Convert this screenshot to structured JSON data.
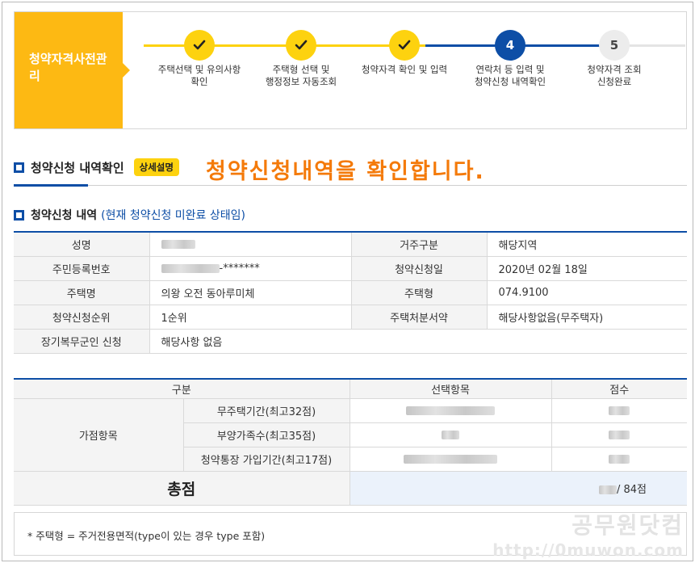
{
  "steps": {
    "tag": "청약자격사전관리",
    "items": [
      {
        "num": "",
        "icon": "check-icon",
        "label1": "주택선택 및 유의사항",
        "label2": "확인",
        "state": "done"
      },
      {
        "num": "",
        "icon": "check-icon",
        "label1": "주택형 선택 및",
        "label2": "행정정보 자동조회",
        "state": "done"
      },
      {
        "num": "",
        "icon": "check-icon",
        "label1": "청약자격 확인 및 입력",
        "label2": "",
        "state": "done"
      },
      {
        "num": "4",
        "icon": "",
        "label1": "연락처 등 입력 및",
        "label2": "청약신청 내역확인",
        "state": "current"
      },
      {
        "num": "5",
        "icon": "",
        "label1": "청약자격 조회",
        "label2": "신청완료",
        "state": "todo"
      }
    ]
  },
  "section": {
    "title": "청약신청 내역확인",
    "badge": "상세설명",
    "annotation": "청약신청내역을 확인합니다."
  },
  "subsection": {
    "title": "청약신청 내역",
    "note": "(현재 청약신청 미완료 상태임)"
  },
  "info": {
    "name_label": "성명",
    "residence_label": "거주구분",
    "residence_value": "해당지역",
    "rrn_label": "주민등록번호",
    "rrn_value": "-*******",
    "date_label": "청약신청일",
    "date_value": "2020년 02월 18일",
    "house_label": "주택명",
    "house_value": "의왕 오전 동아루미체",
    "type_label": "주택형",
    "type_value": "074.9100",
    "rank_label": "청약신청순위",
    "rank_value": "1순위",
    "disposal_label": "주택처분서약",
    "disposal_value": "해당사항없음(무주택자)",
    "military_label": "장기복무군인 신청",
    "military_value": "해당사항 없음"
  },
  "score": {
    "col_category": "구분",
    "col_choice": "선택항목",
    "col_points": "점수",
    "group": "가점항목",
    "rows": [
      {
        "label": "무주택기간(최고32점)"
      },
      {
        "label": "부양가족수(최고35점)"
      },
      {
        "label": "청약통장 가입기간(최고17점)"
      }
    ],
    "total_label": "총점",
    "total_suffix": "/ 84점"
  },
  "footnote": "* 주택형 = 주거전용면적(type이 있는 경우 type 포함)",
  "watermark": {
    "site": "공무원닷컴",
    "url": "http://0muwon.com"
  },
  "colors": {
    "accent_yellow": "#fdb913",
    "brand_blue": "#0d4ea6",
    "annotation_orange": "#f47a0a"
  }
}
